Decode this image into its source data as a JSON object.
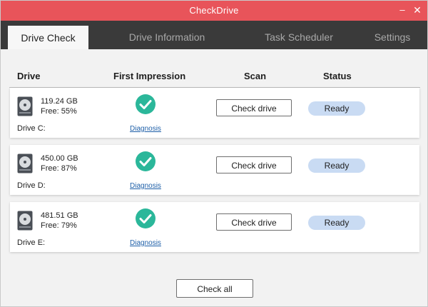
{
  "window": {
    "title": "CheckDrive",
    "minimize_glyph": "–",
    "close_glyph": "✕"
  },
  "tabs": [
    {
      "label": "Drive Check",
      "active": true
    },
    {
      "label": "Drive Information",
      "active": false
    },
    {
      "label": "Task Scheduler",
      "active": false
    },
    {
      "label": "Settings",
      "active": false
    }
  ],
  "columns": {
    "drive": "Drive",
    "first": "First Impression",
    "scan": "Scan",
    "status": "Status"
  },
  "drives": [
    {
      "size": "119.24 GB",
      "free": "Free: 55%",
      "name": "Drive C:",
      "diagnosis": "Diagnosis",
      "scan_label": "Check drive",
      "status": "Ready",
      "icon": "hard-drive-icon"
    },
    {
      "size": "450.00 GB",
      "free": "Free: 87%",
      "name": "Drive D:",
      "diagnosis": "Diagnosis",
      "scan_label": "Check drive",
      "status": "Ready",
      "icon": "hard-drive-icon"
    },
    {
      "size": "481.51 GB",
      "free": "Free: 79%",
      "name": "Drive E:",
      "diagnosis": "Diagnosis",
      "scan_label": "Check drive",
      "status": "Ready",
      "icon": "hard-drive-icon"
    }
  ],
  "footer": {
    "check_all": "Check all"
  },
  "colors": {
    "titlebar": "#e8545a",
    "tabbar": "#3a3a3a",
    "check_green": "#2bb79a",
    "status_bg": "#c9dbf3"
  }
}
